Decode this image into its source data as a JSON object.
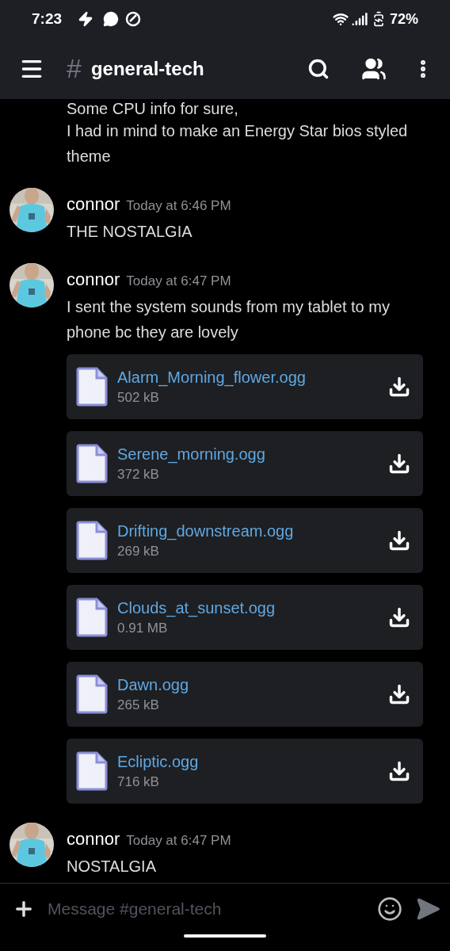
{
  "status_bar": {
    "time": "7:23",
    "battery": "72%"
  },
  "header": {
    "hash": "#",
    "channel": "general-tech"
  },
  "messages": [
    {
      "kind": "continuation",
      "lines": [
        "Some CPU info for sure,",
        "I had in mind to make an Energy Star bios styled theme"
      ]
    },
    {
      "kind": "message",
      "author": "connor",
      "timestamp": "Today at 6:46 PM",
      "text": "THE NOSTALGIA"
    },
    {
      "kind": "message",
      "author": "connor",
      "timestamp": "Today at 6:47 PM",
      "text": "I sent the system sounds from my tablet to my phone bc they are lovely",
      "attachments": [
        {
          "name": "Alarm_Morning_flower.ogg",
          "size": "502 kB"
        },
        {
          "name": "Serene_morning.ogg",
          "size": "372 kB"
        },
        {
          "name": "Drifting_downstream.ogg",
          "size": "269 kB"
        },
        {
          "name": "Clouds_at_sunset.ogg",
          "size": "0.91 MB"
        },
        {
          "name": "Dawn.ogg",
          "size": "265 kB"
        },
        {
          "name": "Ecliptic.ogg",
          "size": "716 kB"
        }
      ]
    },
    {
      "kind": "message",
      "author": "connor",
      "timestamp": "Today at 6:47 PM",
      "text": "NOSTALGIA"
    }
  ],
  "composer": {
    "placeholder": "Message #general-tech"
  }
}
